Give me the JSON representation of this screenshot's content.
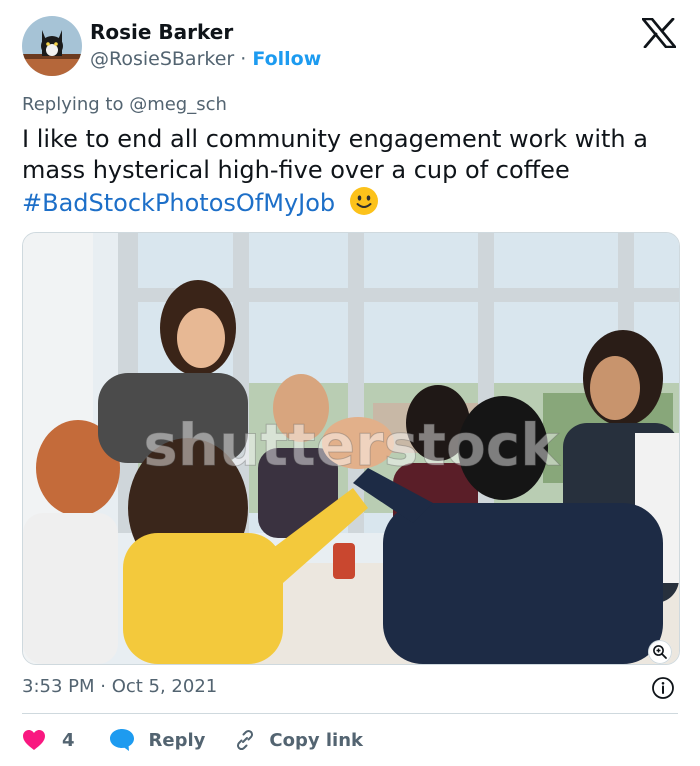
{
  "author": {
    "name": "Rosie Barker",
    "handle": "@RosieSBarker",
    "separator": "·",
    "follow_label": "Follow"
  },
  "reply_context": "Replying to @meg_sch",
  "tweet": {
    "text": "I like to end all community engagement work with a mass hysterical high-five over a cup of coffee",
    "hashtag": "#BadStockPhotosOfMyJob",
    "emoji_icon": "smiley-face-icon"
  },
  "photo": {
    "watermark": "shutterstock",
    "zoom_icon": "zoom-in-icon"
  },
  "timestamp": "3:53 PM · Oct 5, 2021",
  "actions": {
    "like_count": "4",
    "reply_label": "Reply",
    "copy_link_label": "Copy link"
  },
  "colors": {
    "link": "#1d9bf0",
    "hashtag": "#1d6fc8",
    "like": "#f91880",
    "reply": "#1d9bf0",
    "muted": "#536471"
  }
}
